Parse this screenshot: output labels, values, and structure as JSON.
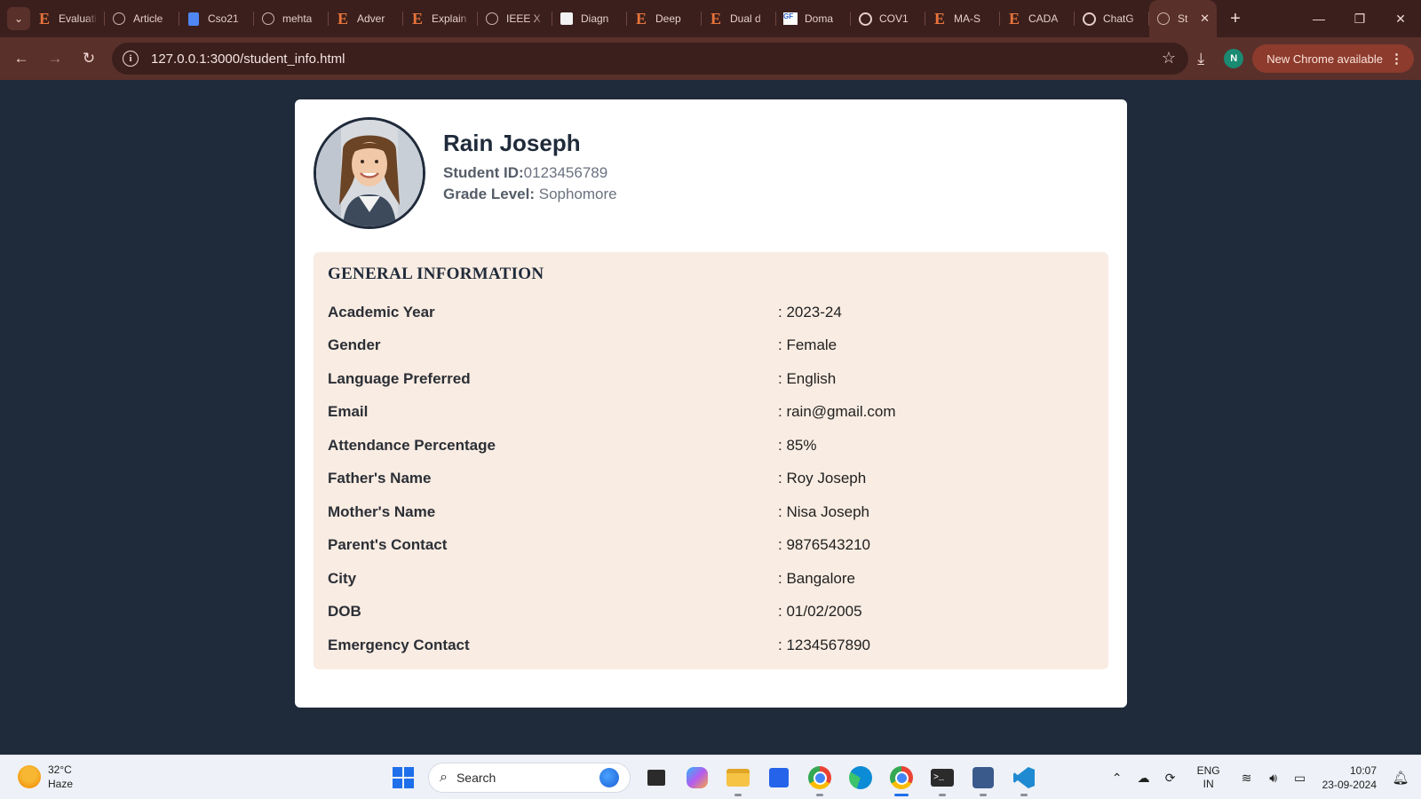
{
  "browser": {
    "tabs": [
      {
        "title": "Evaluation",
        "icon": "e-icon"
      },
      {
        "title": "Article",
        "icon": "globe-icon"
      },
      {
        "title": "Cso21",
        "icon": "doc-icon"
      },
      {
        "title": "mehta",
        "icon": "globe-icon"
      },
      {
        "title": "Adver",
        "icon": "e-icon"
      },
      {
        "title": "Explain",
        "icon": "e-icon"
      },
      {
        "title": "IEEE X",
        "icon": "globe-icon"
      },
      {
        "title": "Diagn",
        "icon": "diagram-icon"
      },
      {
        "title": "Deep",
        "icon": "e-icon"
      },
      {
        "title": "Dual d",
        "icon": "e-icon"
      },
      {
        "title": "Doma",
        "icon": "domain-icon"
      },
      {
        "title": "COV1",
        "icon": "chatgpt-icon"
      },
      {
        "title": "MA-S",
        "icon": "e-icon"
      },
      {
        "title": "CADA",
        "icon": "e-icon"
      },
      {
        "title": "ChatG",
        "icon": "chatgpt-icon"
      }
    ],
    "active_tab_title": "St",
    "url": "127.0.0.1:3000/student_info.html",
    "profile_initial": "N",
    "update_chip": "New Chrome available"
  },
  "student": {
    "name": "Rain Joseph",
    "id_label": "Student ID:",
    "id_value": "0123456789",
    "grade_label": "Grade Level:",
    "grade_value": "Sophomore"
  },
  "general_info": {
    "heading": "GENERAL INFORMATION",
    "rows": [
      {
        "label": "Academic Year",
        "value": ": 2023-24"
      },
      {
        "label": "Gender",
        "value": ": Female"
      },
      {
        "label": "Language Preferred",
        "value": ": English"
      },
      {
        "label": "Email",
        "value": ": rain@gmail.com"
      },
      {
        "label": "Attendance Percentage",
        "value": ": 85%"
      },
      {
        "label": "Father's Name",
        "value": ": Roy Joseph"
      },
      {
        "label": "Mother's Name",
        "value": ": Nisa Joseph"
      },
      {
        "label": "Parent's Contact",
        "value": ": 9876543210"
      },
      {
        "label": "City",
        "value": ": Bangalore"
      },
      {
        "label": "DOB",
        "value": ": 01/02/2005"
      },
      {
        "label": "Emergency Contact",
        "value": ": 1234567890"
      }
    ]
  },
  "taskbar": {
    "weather_temp": "32°C",
    "weather_desc": "Haze",
    "search_placeholder": "Search",
    "lang_top": "ENG",
    "lang_bottom": "IN",
    "time": "10:07",
    "date": "23-09-2024"
  },
  "colors": {
    "page_bg": "#1f2a3a",
    "info_bg": "#f9ece2",
    "chrome_frame": "#3b1f1c",
    "chrome_toolbar": "#5a302b",
    "update_chip": "#8c3b2c"
  }
}
